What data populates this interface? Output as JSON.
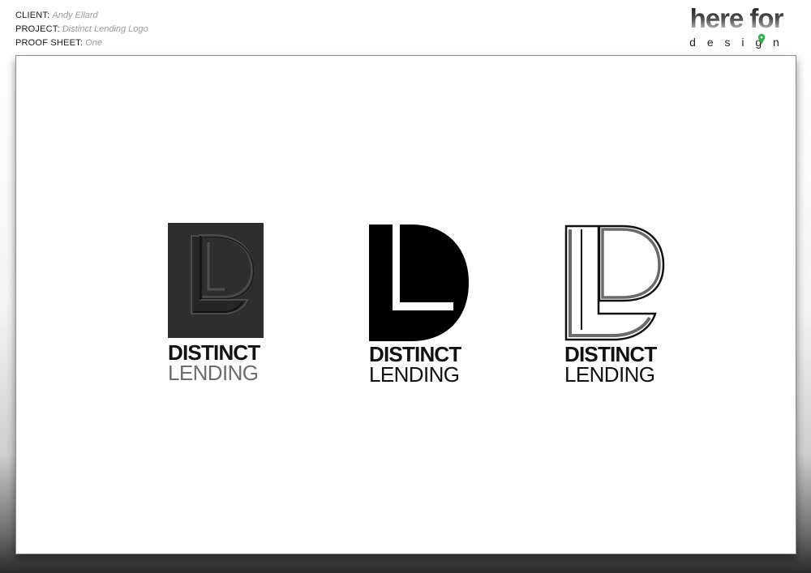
{
  "header": {
    "client_label": "CLIENT:",
    "client_value": "Andy Ellard",
    "project_label": "PROJECT:",
    "project_value": "Distinct Lending Logo",
    "proof_label": "PROOF SHEET:",
    "proof_value": "One"
  },
  "brand": {
    "line1": "here for",
    "line2": "d e s i g n",
    "accent_color": "#2bb34a"
  },
  "logos": [
    {
      "name": "dark-tile-variant",
      "word1": "DISTINCT",
      "word2": "LENDING",
      "word2_color": "#6d6d6d"
    },
    {
      "name": "solid-black-variant",
      "word1": "DISTINCT",
      "word2": "LENDING",
      "word2_color": "#111111"
    },
    {
      "name": "outline-variant",
      "word1": "DISTINCT",
      "word2": "LENDING",
      "word2_color": "#111111"
    }
  ]
}
